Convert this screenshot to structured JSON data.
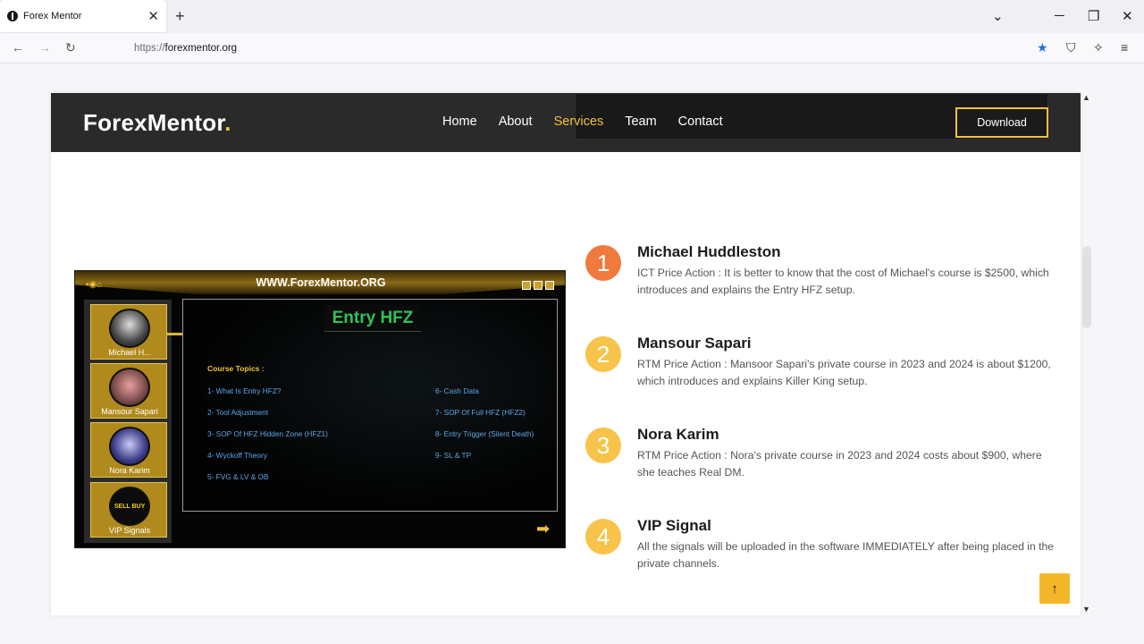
{
  "browser": {
    "tab_title": "Forex Mentor",
    "tab_close": "✕",
    "new_tab": "+",
    "url_protocol": "https://",
    "url_host": "forexmentor.org",
    "controls": {
      "list": "⌄",
      "minimize": "─",
      "restore": "❐",
      "close": "✕"
    },
    "nav": {
      "back": "←",
      "forward": "→",
      "reload": "↻"
    },
    "tools": {
      "bookmark": "★",
      "shield": "⛉",
      "extension": "✧",
      "menu": "≡"
    }
  },
  "site": {
    "logo_text": "ForexMentor",
    "logo_dot": ".",
    "menu": [
      "Home",
      "About",
      "Services",
      "Team",
      "Contact"
    ],
    "active_menu": "Services",
    "download_label": "Download",
    "back_to_top": "↑"
  },
  "app_preview": {
    "title": "WWW.ForexMentor.ORG",
    "left_icons": "▪◉⌂",
    "heading": "Entry HFZ",
    "topics_label": "Course Topics :",
    "topics_left": [
      "1- What Is Entry HFZ?",
      "2- Tool Adjustment",
      "3- SOP Of HFZ Hidden Zone (HFZ1)",
      "4- Wyckoff Theory",
      "5- FVG & LV & OB"
    ],
    "topics_right": [
      "6- Cash Data",
      "7- SOP Of Full HFZ (HFZ2)",
      "8- Entry Trigger (Silent Death)",
      "9- SL & TP"
    ],
    "side_cards": [
      "Michael H...",
      "Mansour Sapari",
      "Nora Karim",
      "VIP Signals"
    ],
    "vip_badge": "SELL BUY",
    "next_arrow": "➡"
  },
  "services": [
    {
      "number": "1",
      "title": "Michael Huddleston",
      "desc": "ICT Price Action : It is better to know that the cost of Michael's course is $2500, which introduces and explains the Entry HFZ setup.",
      "color": "#f07a3e"
    },
    {
      "number": "2",
      "title": "Mansour Sapari",
      "desc": "RTM Price Action : Mansoor Sapari's private course in 2023 and 2024 is about $1200, which introduces and explains Killer King setup.",
      "color": "#f7c34a"
    },
    {
      "number": "3",
      "title": "Nora Karim",
      "desc": "RTM Price Action : Nora's private course in 2023 and 2024 costs about $900, where she teaches Real DM.",
      "color": "#f7c34a"
    },
    {
      "number": "4",
      "title": "VIP Signal",
      "desc": "All the signals will be uploaded in the software IMMEDIATELY after being placed in the private channels.",
      "color": "#f7c34a"
    }
  ],
  "scrollbar": {
    "up": "▲",
    "down": "▼"
  }
}
